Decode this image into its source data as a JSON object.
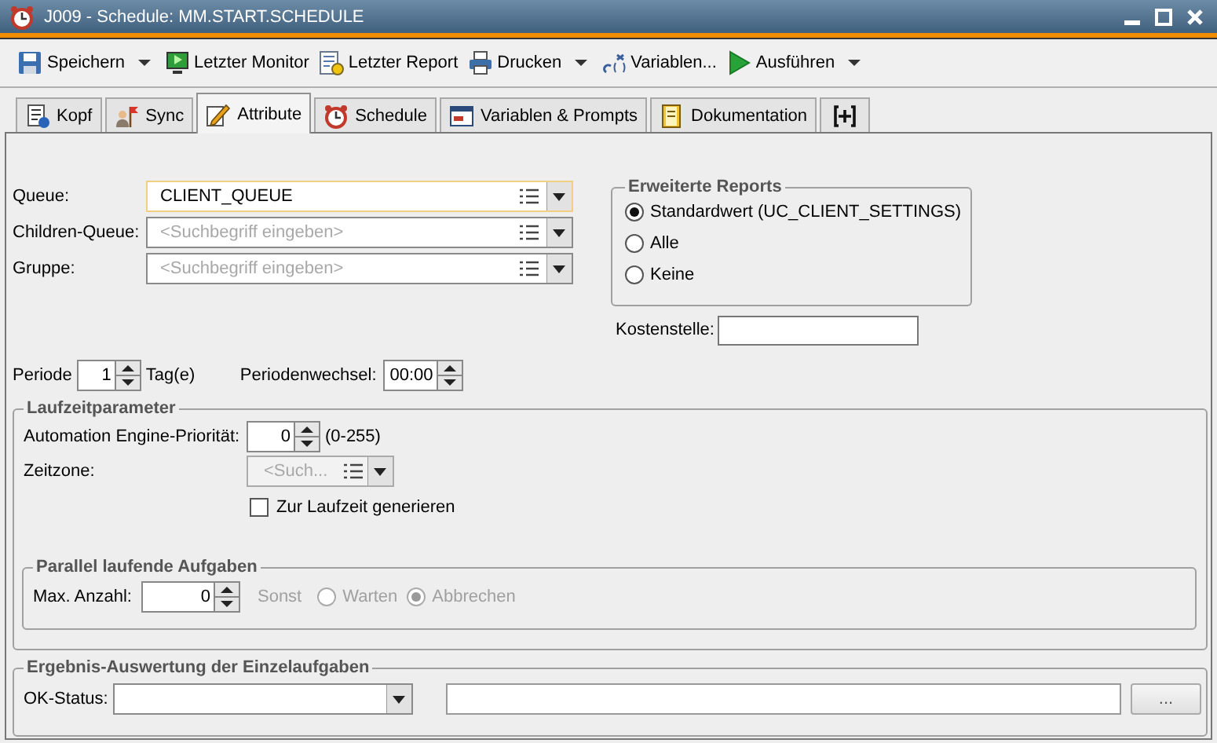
{
  "window": {
    "title": "J009 - Schedule: MM.START.SCHEDULE"
  },
  "toolbar": [
    {
      "label": "Speichern",
      "kind": "split"
    },
    {
      "label": "Letzter Monitor",
      "kind": "button"
    },
    {
      "label": "Letzter Report",
      "kind": "button"
    },
    {
      "label": "Drucken",
      "kind": "split"
    },
    {
      "label": "Variablen...",
      "kind": "button"
    },
    {
      "label": "Ausführen",
      "kind": "split"
    }
  ],
  "tabs": [
    {
      "label": "Kopf",
      "selected": false
    },
    {
      "label": "Sync",
      "selected": false
    },
    {
      "label": "Attribute",
      "selected": true
    },
    {
      "label": "Schedule",
      "selected": false
    },
    {
      "label": "Variablen & Prompts",
      "selected": false
    },
    {
      "label": "Dokumentation",
      "selected": false
    }
  ],
  "queue_fields": [
    {
      "label": "Queue:",
      "value": "CLIENT_QUEUE",
      "focused": true
    },
    {
      "label": "Children-Queue:",
      "placeholder": "<Suchbegriff eingeben>",
      "focused": false
    },
    {
      "label": "Gruppe:",
      "placeholder": "<Suchbegriff eingeben>",
      "focused": false
    }
  ],
  "extended_reports": {
    "title": "Erweiterte Reports",
    "options": [
      {
        "label": "Standardwert (UC_CLIENT_SETTINGS)",
        "selected": true
      },
      {
        "label": "Alle",
        "selected": false
      },
      {
        "label": "Keine",
        "selected": false
      }
    ]
  },
  "cost_center": {
    "label": "Kostenstelle:"
  },
  "period": {
    "label": "Periode",
    "value": "1",
    "unit": "Tag(e)"
  },
  "period_change": {
    "label": "Periodenwechsel:",
    "value": "00:00"
  },
  "runtime": {
    "title": "Laufzeitparameter",
    "priority": {
      "label": "Automation Engine-Priorität:",
      "value": "0",
      "range": "(0-255)"
    },
    "timezone": {
      "label": "Zeitzone:",
      "placeholder": "<Such...",
      "disabled": true
    },
    "generate": {
      "label": "Zur Laufzeit generieren",
      "checked": false
    },
    "parallel": {
      "title": "Parallel laufende Aufgaben",
      "label": "Max. Anzahl:",
      "value": "0",
      "otherwise": "Sonst",
      "options": [
        {
          "label": "Warten",
          "selected": false,
          "disabled": true
        },
        {
          "label": "Abbrechen",
          "selected": true,
          "disabled": true
        }
      ]
    }
  },
  "result": {
    "title": "Ergebnis-Auswertung der Einzelaufgaben",
    "ok_status": {
      "label": "OK-Status:"
    },
    "button": "..."
  }
}
